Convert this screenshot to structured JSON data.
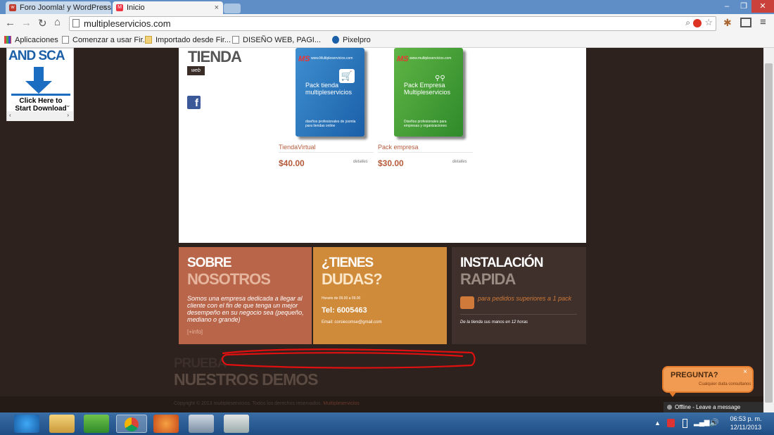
{
  "browser": {
    "tabs": [
      {
        "label": "Foro Joomla! y WordPress"
      },
      {
        "label": "Inicio"
      }
    ],
    "url": "multipleservicios.com",
    "bookmarks": [
      "Aplicaciones",
      "Comenzar a usar Fir...",
      "Importado desde Fir...",
      "DISEÑO WEB, PAGI...",
      "Pixelpro"
    ]
  },
  "ad": {
    "headline": "AND SCA",
    "cta": "Click Here to Start Download"
  },
  "shop": {
    "title": "TIENDA",
    "tag": "web",
    "products": [
      {
        "name": "TiendaVirtual",
        "price": "$40.00",
        "detail": "detalles",
        "box_logo": "MS",
        "box_url": "www.Multipleservicios.com",
        "box_name": "Pack tienda multipleservicios",
        "box_desc": "diseños profesionales de joomla para tiendas online"
      },
      {
        "name": "Pack empresa",
        "price": "$30.00",
        "detail": "detalles",
        "box_logo": "MS",
        "box_url": "www.multipleservicios.com",
        "box_name": "Pack Empresa Multipleservicios",
        "box_desc": "Diseños profesionales para empresas y organizaciones"
      }
    ]
  },
  "panels": {
    "about": {
      "line1": "SOBRE",
      "line2": "NOSOTROS",
      "text": "Somos una empresa dedicada a llegar al cliente con el fin de que tenga un mejor desempeño en su negocio sea (pequeño, mediano o grande)",
      "link": "[+info]"
    },
    "doubts": {
      "line1": "¿TIENES",
      "line2": "DUDAS?",
      "hours": "Horario de 09.00 a 09.00",
      "phone": "Tel: 6005463",
      "email": "Email:  corsiecomse@gmail.com"
    },
    "install": {
      "line1": "INSTALACIÓN",
      "line2": "RAPIDA",
      "text": "para pedidos superiores a 1 pack",
      "note": "De la tienda  sus manos en 12 horas"
    }
  },
  "demos": {
    "line1": "PRUEBA",
    "line2": "NUESTROS DEMOS"
  },
  "footer": {
    "copyright": "Copyright © 2013 multipleservicios. Todos los derechos reservados.",
    "brand": "Multipleservicios"
  },
  "chat": {
    "title": "PREGUNTA?",
    "subtitle": "Cualquier duda consultanos",
    "close": "×",
    "status": "Offline - Leave a message"
  },
  "tray": {
    "time": "06:53 p. m.",
    "date": "12/11/2013"
  },
  "colors": {
    "accent_red": "#b55a3a",
    "panel_about": "#b9654a",
    "panel_doubts": "#cf8a3a",
    "panel_install": "#3f302b",
    "chat_orange": "#f19b52"
  }
}
